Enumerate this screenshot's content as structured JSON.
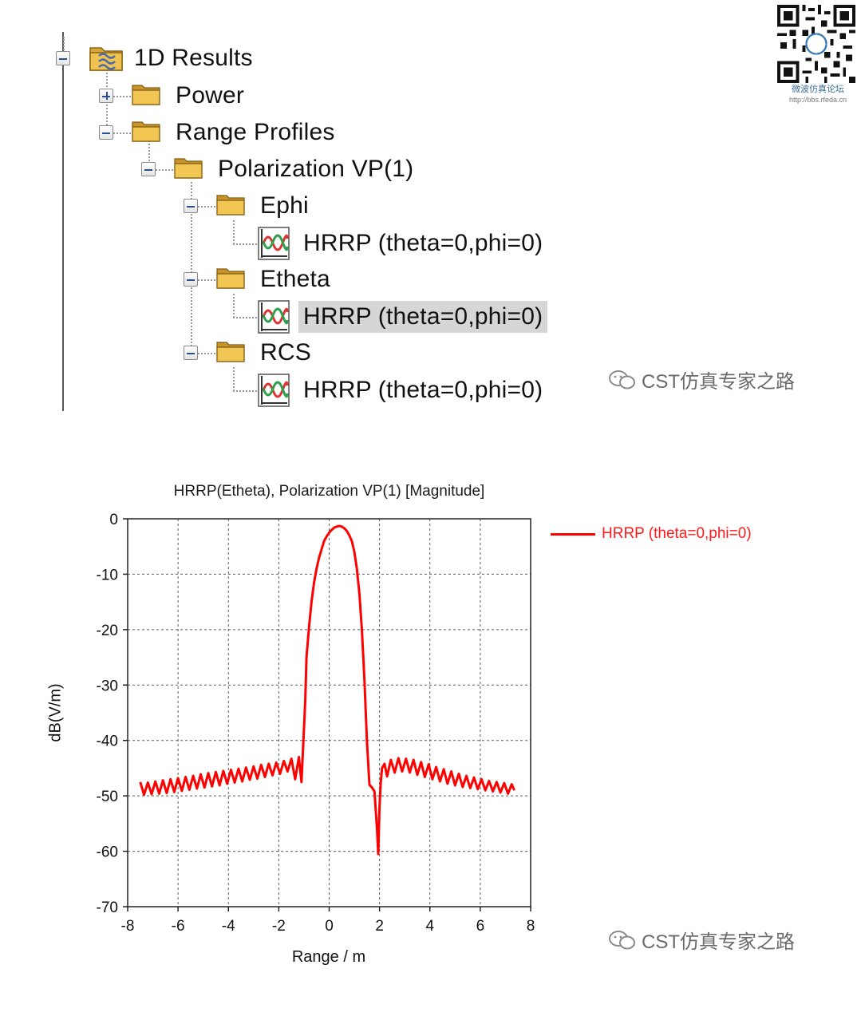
{
  "tree": {
    "items": [
      {
        "label": "1D Results"
      },
      {
        "label": "Power"
      },
      {
        "label": "Range Profiles"
      },
      {
        "label": "Polarization VP(1)"
      },
      {
        "label": "Ephi"
      },
      {
        "label": "HRRP (theta=0,phi=0)"
      },
      {
        "label": "Etheta"
      },
      {
        "label": "HRRP (theta=0,phi=0)"
      },
      {
        "label": "RCS"
      },
      {
        "label": "HRRP (theta=0,phi=0)"
      }
    ]
  },
  "watermark": {
    "qr_caption": "微波仿真论坛",
    "qr_url": "http://bbs.rfeda.cn",
    "brand_top": "CST仿真专家之路",
    "brand_bottom": "CST仿真专家之路"
  },
  "chart_data": {
    "type": "line",
    "title": "HRRP(Etheta), Polarization VP(1) [Magnitude]",
    "xlabel": "Range / m",
    "ylabel": "dB(V/m)",
    "xlim": [
      -8,
      8
    ],
    "ylim": [
      -70,
      0
    ],
    "xticks": [
      -8,
      -6,
      -4,
      -2,
      0,
      2,
      4,
      6,
      8
    ],
    "yticks": [
      0,
      -10,
      -20,
      -30,
      -40,
      -50,
      -60,
      -70
    ],
    "grid": true,
    "legend_position": "right",
    "series": [
      {
        "name": "HRRP (theta=0,phi=0)",
        "color": "#ff0000",
        "x": [
          -7.5,
          -7.35,
          -7.2,
          -7.05,
          -6.9,
          -6.75,
          -6.6,
          -6.45,
          -6.3,
          -6.15,
          -6.0,
          -5.85,
          -5.7,
          -5.55,
          -5.4,
          -5.25,
          -5.1,
          -4.95,
          -4.8,
          -4.65,
          -4.5,
          -4.35,
          -4.2,
          -4.05,
          -3.9,
          -3.75,
          -3.6,
          -3.45,
          -3.3,
          -3.15,
          -3.0,
          -2.85,
          -2.7,
          -2.55,
          -2.4,
          -2.25,
          -2.1,
          -1.95,
          -1.8,
          -1.65,
          -1.5,
          -1.35,
          -1.2,
          -1.1,
          -1.0,
          -0.95,
          -0.9,
          -0.8,
          -0.7,
          -0.6,
          -0.5,
          -0.4,
          -0.3,
          -0.2,
          -0.1,
          0.0,
          0.1,
          0.2,
          0.3,
          0.4,
          0.5,
          0.6,
          0.7,
          0.8,
          0.9,
          1.0,
          1.1,
          1.2,
          1.3,
          1.4,
          1.5,
          1.6,
          1.7,
          1.8,
          1.9,
          1.95,
          2.0,
          2.05,
          2.1,
          2.2,
          2.3,
          2.45,
          2.6,
          2.75,
          2.9,
          3.05,
          3.2,
          3.35,
          3.5,
          3.65,
          3.8,
          3.95,
          4.1,
          4.25,
          4.4,
          4.55,
          4.7,
          4.85,
          5.0,
          5.15,
          5.3,
          5.45,
          5.6,
          5.75,
          5.9,
          6.05,
          6.2,
          6.35,
          6.5,
          6.65,
          6.8,
          6.95,
          7.1,
          7.25,
          7.35
        ],
        "y": [
          -47.5,
          -49.8,
          -47.6,
          -49.7,
          -47.4,
          -49.6,
          -47.2,
          -49.5,
          -47.0,
          -49.3,
          -46.8,
          -49.1,
          -46.6,
          -48.9,
          -46.4,
          -48.7,
          -46.1,
          -48.5,
          -45.9,
          -48.3,
          -45.7,
          -48.1,
          -45.5,
          -47.8,
          -45.3,
          -47.6,
          -45.1,
          -47.4,
          -44.9,
          -47.1,
          -44.7,
          -46.9,
          -44.4,
          -46.6,
          -44.2,
          -46.3,
          -44.0,
          -46.0,
          -43.7,
          -45.6,
          -43.3,
          -47.0,
          -43.0,
          -47.5,
          -38.0,
          -33.0,
          -25.0,
          -19.5,
          -15.0,
          -11.5,
          -9.0,
          -7.0,
          -5.5,
          -4.0,
          -3.2,
          -2.5,
          -2.0,
          -1.6,
          -1.4,
          -1.3,
          -1.4,
          -1.7,
          -2.2,
          -3.0,
          -4.0,
          -6.0,
          -9.0,
          -13.5,
          -20.0,
          -29.0,
          -40.0,
          -48.0,
          -48.5,
          -49.2,
          -56.0,
          -60.5,
          -52.0,
          -47.5,
          -45.0,
          -44.2,
          -46.5,
          -43.5,
          -45.8,
          -43.2,
          -45.6,
          -43.3,
          -45.8,
          -43.5,
          -46.2,
          -43.9,
          -46.6,
          -44.3,
          -47.0,
          -44.8,
          -47.4,
          -45.2,
          -47.8,
          -45.6,
          -48.1,
          -46.0,
          -48.4,
          -46.4,
          -48.6,
          -46.7,
          -48.8,
          -47.0,
          -49.0,
          -47.3,
          -49.2,
          -47.5,
          -49.4,
          -47.7,
          -49.6,
          -47.9,
          -49.0
        ]
      }
    ]
  }
}
